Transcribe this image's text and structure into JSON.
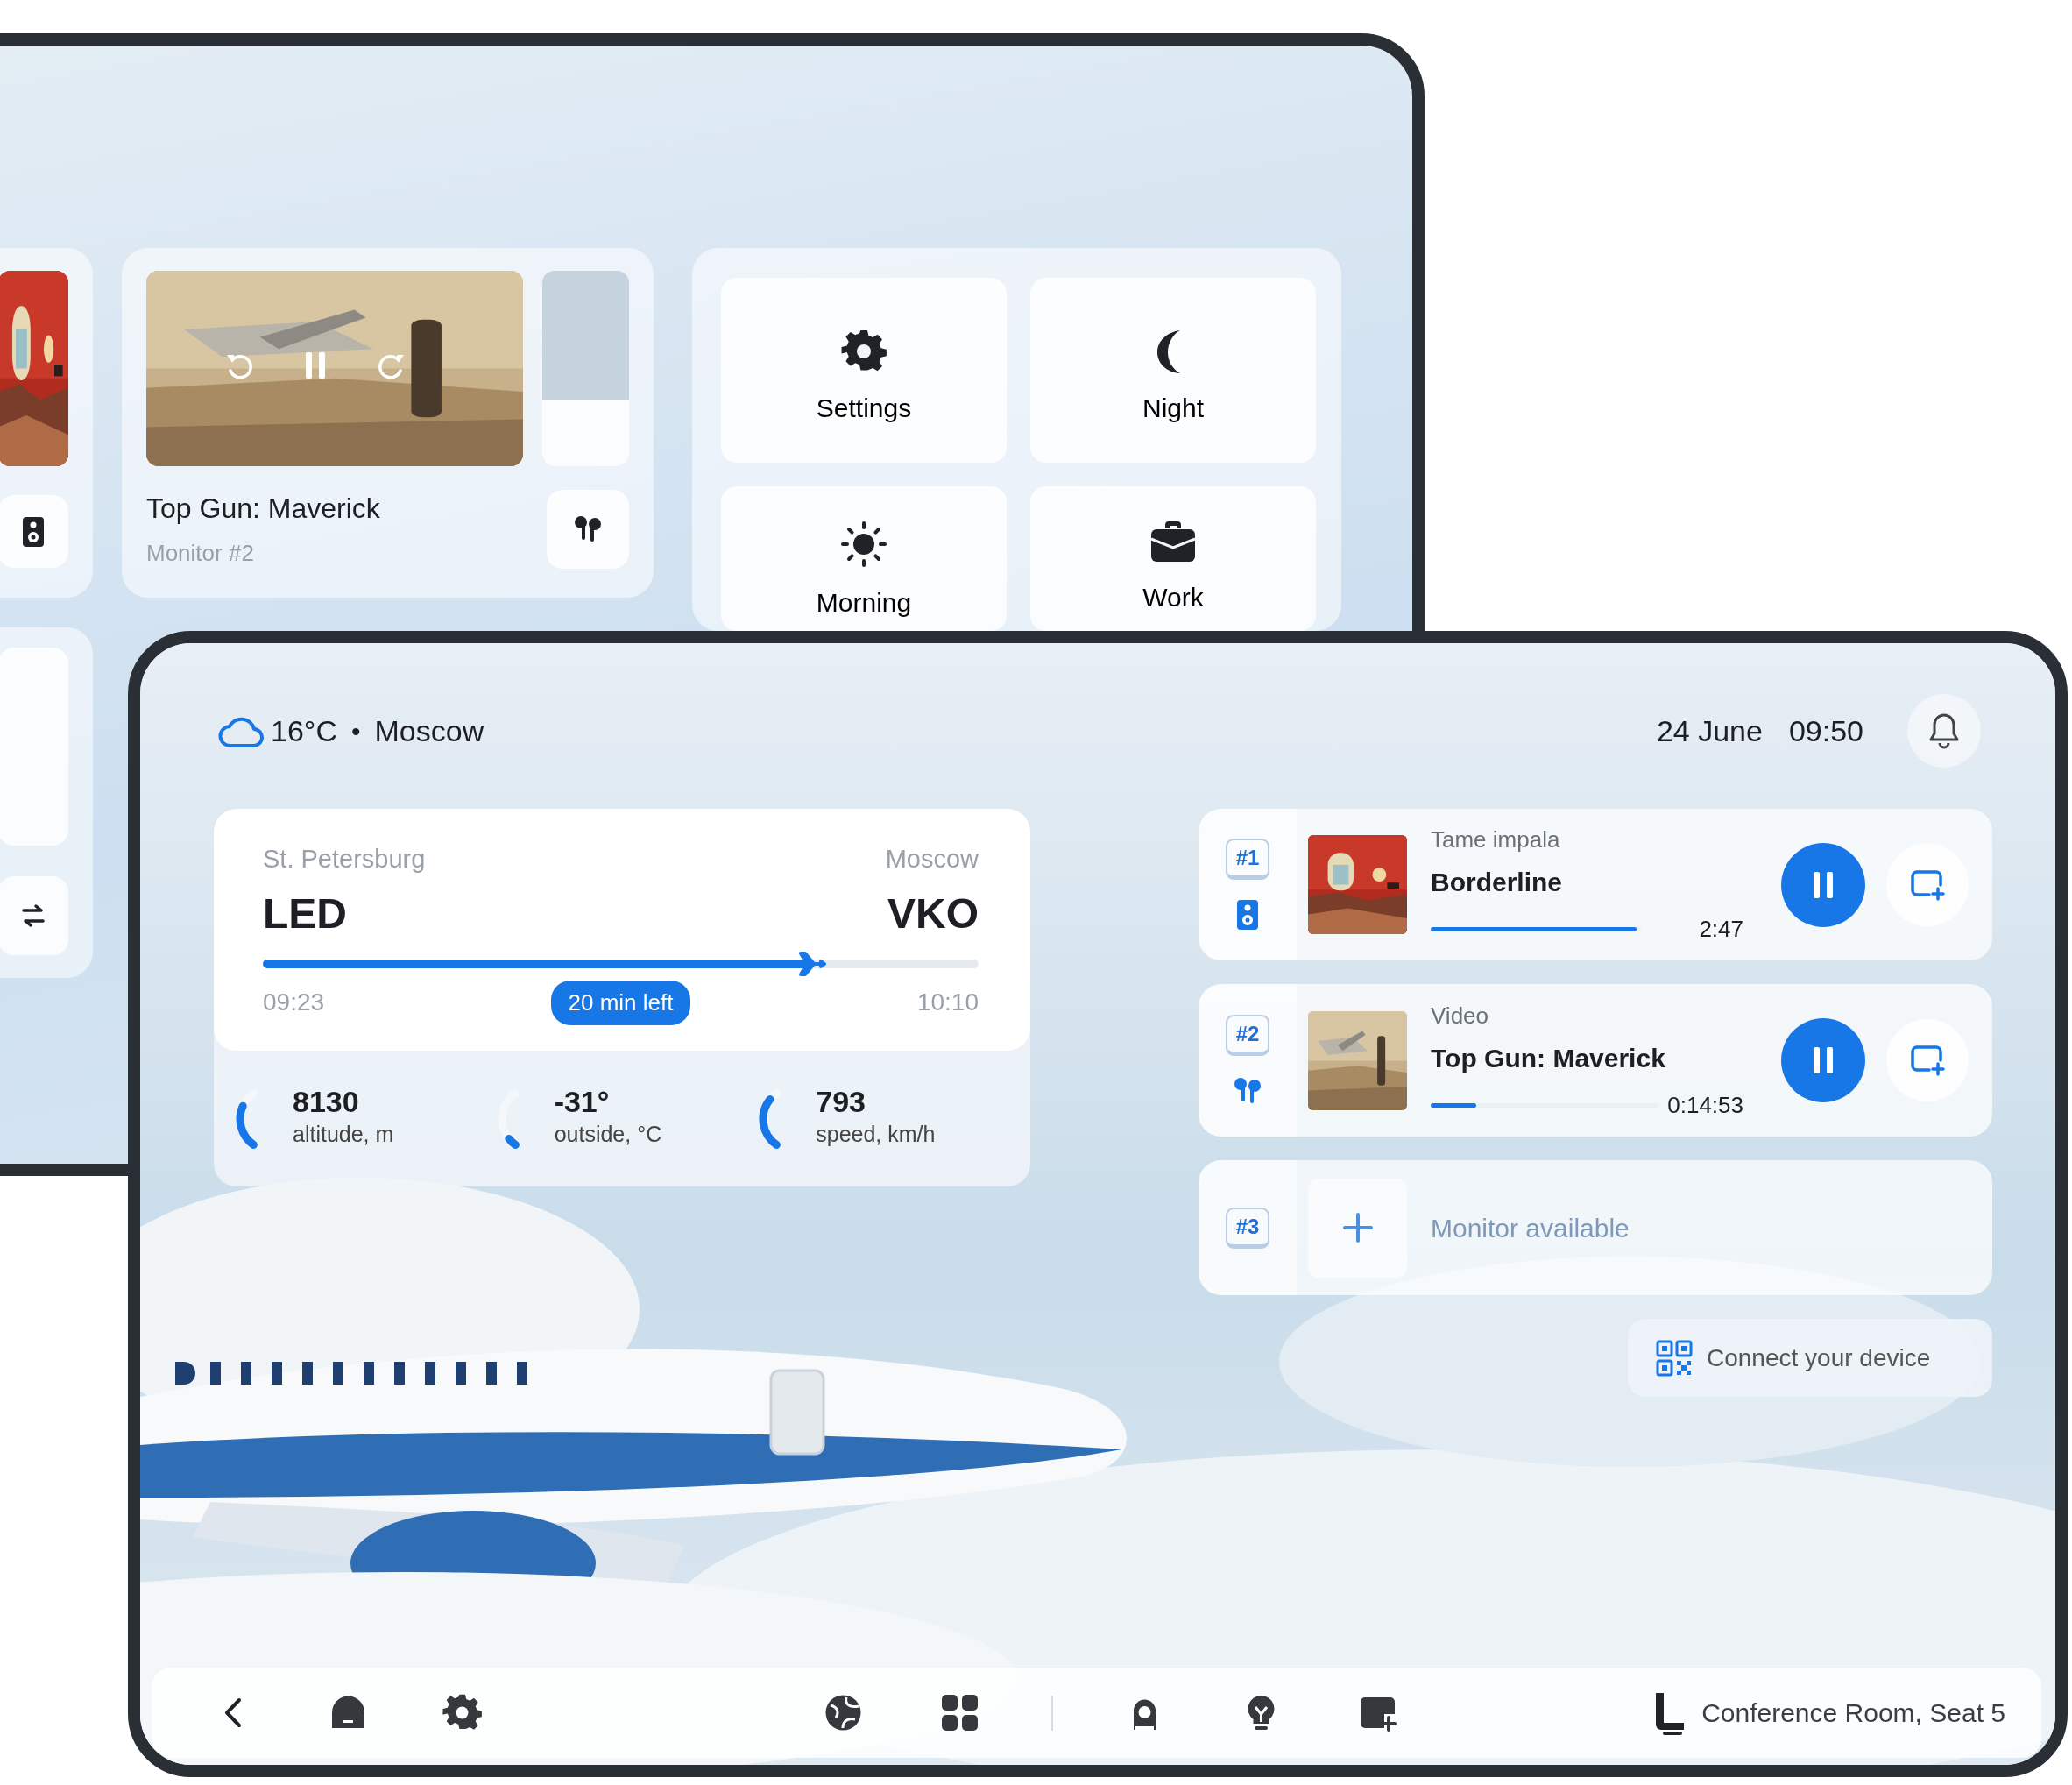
{
  "back_screen": {
    "media_cards": [
      {
        "kind": "cropped"
      },
      {
        "kind": "video",
        "title": "Top Gun: Maverick",
        "subtitle": "Monitor #2",
        "level": 0.34
      }
    ],
    "scenes": [
      {
        "kind": "settings",
        "label": "Settings"
      },
      {
        "kind": "night",
        "label": "Night"
      },
      {
        "kind": "morning",
        "label": "Morning"
      },
      {
        "kind": "work",
        "label": "Work"
      }
    ]
  },
  "front_screen": {
    "weather": {
      "temperature": "16°C",
      "separator": "•",
      "city": "Moscow"
    },
    "date": "24 June",
    "time": "09:50",
    "flight": {
      "from_city": "St. Petersburg",
      "from_code": "LED",
      "to_city": "Moscow",
      "to_code": "VKO",
      "level": 0.76,
      "departure": "09:23",
      "remaining": "20 min left",
      "arrival": "10:10"
    },
    "stats": [
      {
        "value": "8130",
        "label": "altitude, m",
        "level": 0.72
      },
      {
        "value": "-31°",
        "label": "outside, °C",
        "level": 0.15
      },
      {
        "value": "793",
        "label": "speed, km/h",
        "level": 0.85
      }
    ],
    "monitors": [
      {
        "kind": "media",
        "number": "#1",
        "subtitle": "Tame impala",
        "title": "Borderline",
        "level": 0.98,
        "time": "2:47",
        "playing": true
      },
      {
        "kind": "media",
        "number": "#2",
        "subtitle": "Video",
        "title": "Top Gun: Maverick",
        "level": 0.2,
        "time": "0:14:53",
        "playing": true
      },
      {
        "kind": "empty",
        "number": "#3",
        "label": "Monitor available"
      }
    ],
    "connect_button": "Connect your device",
    "seat": "Conference Room, Seat 5"
  }
}
